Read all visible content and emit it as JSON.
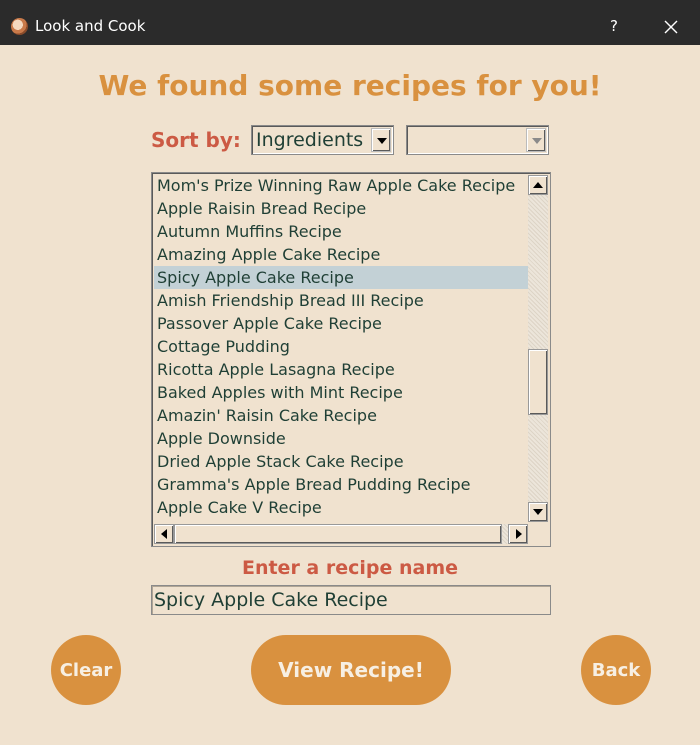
{
  "window": {
    "title": "Look and Cook",
    "help_label": "?",
    "icon": "app-logo-icon"
  },
  "heading": "We found some recipes for you!",
  "sort": {
    "label": "Sort by:",
    "selected": "Ingredients",
    "second_selected": ""
  },
  "recipes": {
    "items": [
      "Mom's Prize Winning Raw Apple Cake Recipe",
      "Apple Raisin Bread Recipe",
      "Autumn Muffins Recipe",
      "Amazing Apple Cake Recipe",
      "Spicy Apple Cake Recipe",
      "Amish Friendship Bread III Recipe",
      "Passover Apple Cake Recipe",
      "Cottage Pudding",
      "Ricotta Apple Lasagna Recipe",
      "Baked Apples with Mint Recipe",
      "Amazin' Raisin Cake Recipe",
      "Apple Downside",
      "Dried Apple Stack Cake Recipe",
      "Gramma's Apple Bread Pudding Recipe",
      "Apple Cake V Recipe"
    ],
    "selected": "Spicy Apple Cake Recipe"
  },
  "entry": {
    "label": "Enter a recipe name",
    "value": "Spicy Apple Cake Recipe"
  },
  "buttons": {
    "clear": "Clear",
    "view": "View Recipe!",
    "back": "Back"
  },
  "colors": {
    "background": "#f0e2cf",
    "accent": "#d9913f",
    "label_red": "#cc5a44",
    "text": "#1f3f35",
    "selection": "#c3d1d6"
  }
}
